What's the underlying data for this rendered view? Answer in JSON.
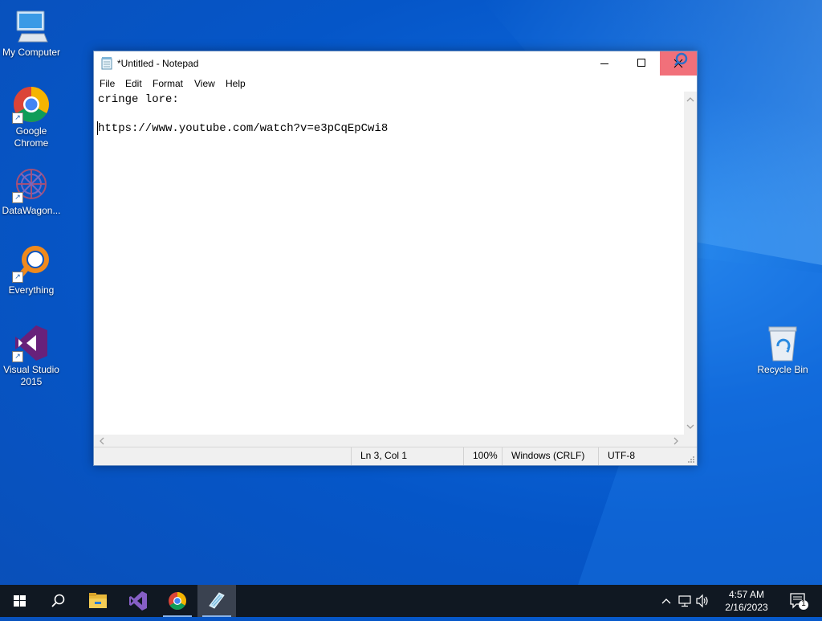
{
  "desktop": {
    "icons": [
      {
        "label": "My Computer"
      },
      {
        "label": "Google Chrome"
      },
      {
        "label": "DataWagon..."
      },
      {
        "label": "Everything"
      },
      {
        "label": "Visual Studio 2015"
      },
      {
        "label": "Recycle Bin"
      }
    ]
  },
  "notepad": {
    "title": "*Untitled - Notepad",
    "menu": [
      "File",
      "Edit",
      "Format",
      "View",
      "Help"
    ],
    "lines": [
      "cringe lore:",
      "",
      "https://www.youtube.com/watch?v=e3pCqEpCwi8"
    ],
    "status": {
      "position": "Ln 3, Col 1",
      "zoom": "100%",
      "line_endings": "Windows (CRLF)",
      "encoding": "UTF-8"
    }
  },
  "taskbar": {
    "items": [
      {
        "name": "start-icon"
      },
      {
        "name": "search-icon"
      },
      {
        "name": "file-explorer-icon"
      },
      {
        "name": "visual-studio-icon"
      },
      {
        "name": "chrome-icon"
      },
      {
        "name": "notepad-icon"
      }
    ],
    "time": "4:57 AM",
    "date": "2/16/2023",
    "notification_count": "1"
  }
}
